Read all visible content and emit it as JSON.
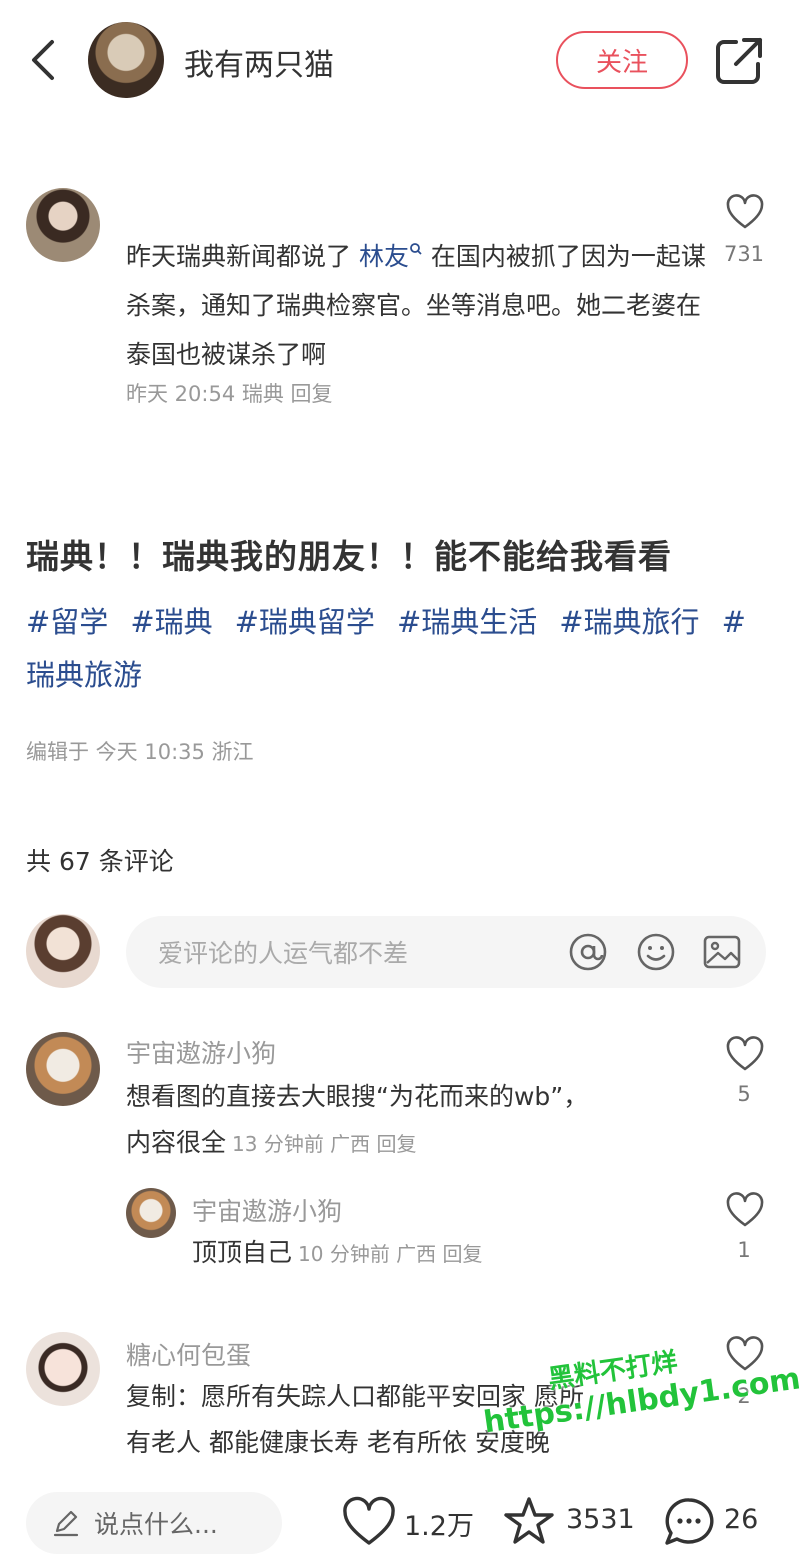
{
  "header": {
    "author_name": "我有两只猫",
    "follow_label": "关注"
  },
  "pinned_comment": {
    "text_before": "昨天瑞典新闻都说了 ",
    "link_text": "林友",
    "text_after": " 在国内被抓了因为一起谋杀案，通知了瑞典检察官。坐等消息吧。她二老婆在泰国也被谋杀了啊",
    "meta": "昨天 20:54 瑞典 回复",
    "likes": "731"
  },
  "post": {
    "title": "瑞典！！瑞典我的朋友！！能不能给我看看",
    "tags": [
      "#留学",
      "#瑞典",
      "#瑞典留学",
      "#瑞典生活",
      "#瑞典旅行",
      "#瑞典旅游"
    ],
    "edited": "编辑于 今天 10:35 浙江",
    "comment_count": "共 67 条评论"
  },
  "comment_input": {
    "placeholder": "爱评论的人运气都不差"
  },
  "comments": [
    {
      "name": "宇宙遨游小狗",
      "text_line1": "想看图的直接去大眼搜“为花而来的wb”，",
      "text_line2": "内容很全",
      "meta": "13 分钟前 广西 回复",
      "likes": "5",
      "reply": {
        "name": "宇宙遨游小狗",
        "text": "顶顶自己",
        "meta": "10 分钟前 广西 回复",
        "likes": "1"
      }
    },
    {
      "name": "糖心何包蛋",
      "text_line1": "复制：愿所有失踪人口都能平安回家 愿所",
      "text_line2": "有老人 都能健康长寿 老有所依 安度晚",
      "likes": "2"
    }
  ],
  "watermark": {
    "line1": "黑料不打烊",
    "line2": "https://hlbdy1.com"
  },
  "bottom_bar": {
    "say_placeholder": "说点什么...",
    "likes": "1.2万",
    "stars": "3531",
    "comments": "26"
  },
  "colors": {
    "accent_red": "#e9515d",
    "link_blue": "#2b4d8f",
    "watermark_green": "#22c33a"
  }
}
